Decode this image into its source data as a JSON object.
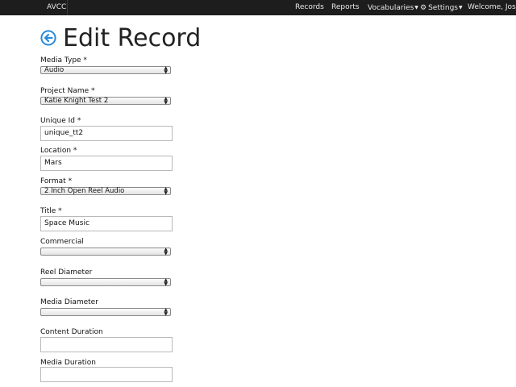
{
  "header": {
    "brand": "AVCC",
    "nav": {
      "records": "Records",
      "reports": "Reports",
      "vocabularies": "Vocabularies",
      "settings": "Settings",
      "welcome": "Welcome, Josh R"
    }
  },
  "page": {
    "title": "Edit Record",
    "back_icon": "circle-arrow-left-icon"
  },
  "form": {
    "media_type": {
      "label": "Media Type *",
      "value": "Audio"
    },
    "project_name": {
      "label": "Project Name *",
      "value": "Katie Knight Test 2"
    },
    "unique_id": {
      "label": "Unique Id *",
      "value": "unique_tt2"
    },
    "location": {
      "label": "Location *",
      "value": "Mars"
    },
    "format": {
      "label": "Format *",
      "value": "2 Inch Open Reel Audio"
    },
    "title": {
      "label": "Title *",
      "value": "Space Music"
    },
    "commercial": {
      "label": "Commercial",
      "value": ""
    },
    "reel_diameter": {
      "label": "Reel Diameter",
      "value": ""
    },
    "media_diameter": {
      "label": "Media Diameter",
      "value": ""
    },
    "content_duration": {
      "label": "Content Duration",
      "value": ""
    },
    "media_duration": {
      "label": "Media Duration",
      "value": ""
    }
  },
  "colors": {
    "topbar": "#1d1d1d",
    "accent": "#2b8ad8"
  }
}
